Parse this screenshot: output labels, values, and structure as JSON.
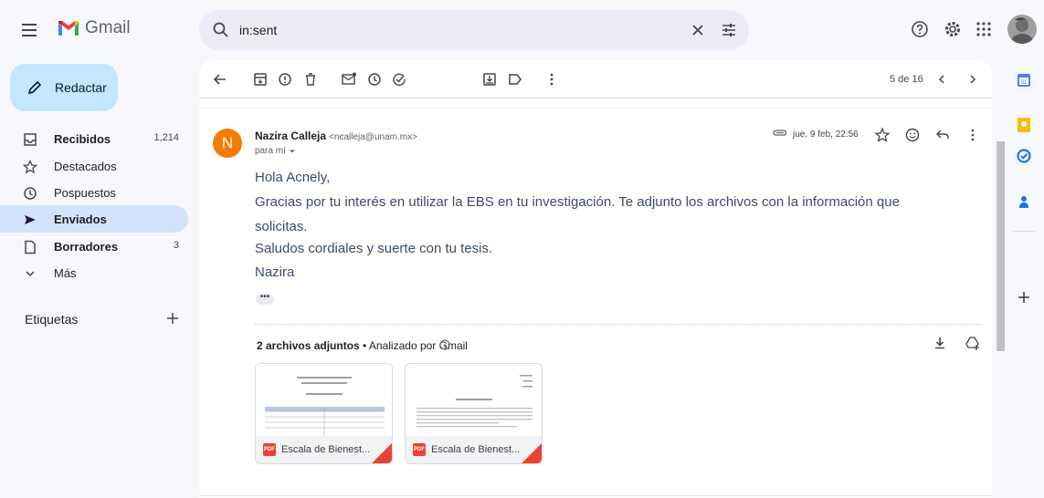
{
  "app": {
    "name": "Gmail"
  },
  "search": {
    "value": "in:sent"
  },
  "sidebar": {
    "compose_label": "Redactar",
    "items": [
      {
        "label": "Recibidos",
        "count": "1,214"
      },
      {
        "label": "Destacados",
        "count": ""
      },
      {
        "label": "Pospuestos",
        "count": ""
      },
      {
        "label": "Enviados",
        "count": ""
      },
      {
        "label": "Borradores",
        "count": "3"
      },
      {
        "label": "Más",
        "count": ""
      }
    ],
    "labels_title": "Etiquetas"
  },
  "toolbar": {
    "pager": "5 de 16"
  },
  "message": {
    "sender_initial": "N",
    "sender_name": "Nazira Calleja",
    "sender_email": "<ncalleja@unam.mx>",
    "recipient": "para mí",
    "date": "jue, 9 feb, 22:56",
    "body": [
      "Hola Acnely,",
      "Gracias por tu interés en utilizar la EBS en tu investigación. Te adjunto los archivos con la información que",
      "solicitas.",
      "Saludos cordiales y suerte con tu tesis.",
      "Nazira"
    ],
    "ellipsis": "•••"
  },
  "attachments": {
    "count_label": "2 archivos adjuntos",
    "scan_label": " • Analizado por Gmail",
    "files": [
      {
        "name": "Escala de Bienest..."
      },
      {
        "name": "Escala de Bienest..."
      }
    ],
    "pdf_badge": "PDF"
  },
  "colors": {
    "accent": "#0b57d0",
    "compose_bg": "#c2e7ff",
    "active_nav": "#d3e3fd",
    "avatar_bg": "#f57c00",
    "pdf_red": "#ea4335"
  }
}
